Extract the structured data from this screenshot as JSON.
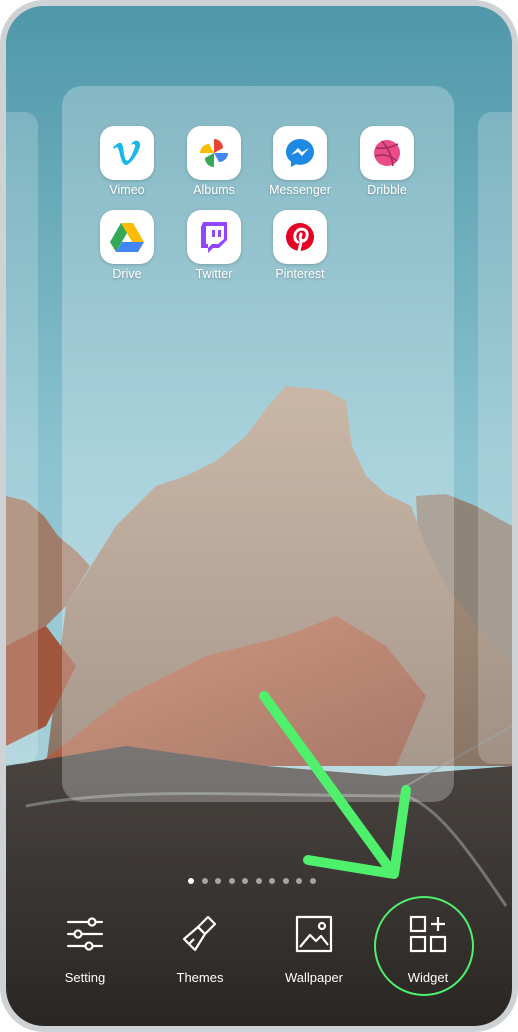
{
  "apps": [
    {
      "label": "Vimeo",
      "icon": "vimeo-icon"
    },
    {
      "label": "Albums",
      "icon": "albums-pinwheel-icon"
    },
    {
      "label": "Messenger",
      "icon": "messenger-icon"
    },
    {
      "label": "Dribble",
      "icon": "dribbble-icon"
    },
    {
      "label": "Drive",
      "icon": "drive-icon"
    },
    {
      "label": "Twitter",
      "icon": "twitch-icon"
    },
    {
      "label": "Pinterest",
      "icon": "pinterest-icon"
    }
  ],
  "page_indicator": {
    "count": 10,
    "active": 1
  },
  "toolbar": {
    "setting": "Setting",
    "themes": "Themes",
    "wallpaper": "Wallpaper",
    "widget": "Widget"
  },
  "colors": {
    "annotation_green": "#4ff06b",
    "vimeo": "#1ab7ea",
    "messenger": "#1e88e5",
    "dribbble": "#ea4c89",
    "twitch": "#9146ff",
    "pinterest": "#e60023"
  }
}
